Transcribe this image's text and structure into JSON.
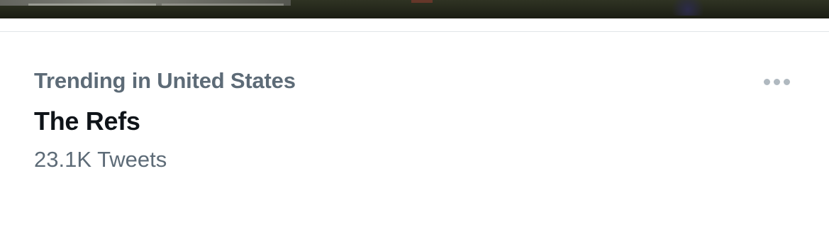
{
  "trend": {
    "context": "Trending in United States",
    "title": "The Refs",
    "count": "23.1K Tweets"
  },
  "icons": {
    "more": "more-horizontal-icon"
  },
  "colors": {
    "secondary_text": "#5d6b77",
    "primary_text": "#0f1419",
    "separator": "#e1e5e8",
    "more_dots": "#b0b9c0"
  }
}
